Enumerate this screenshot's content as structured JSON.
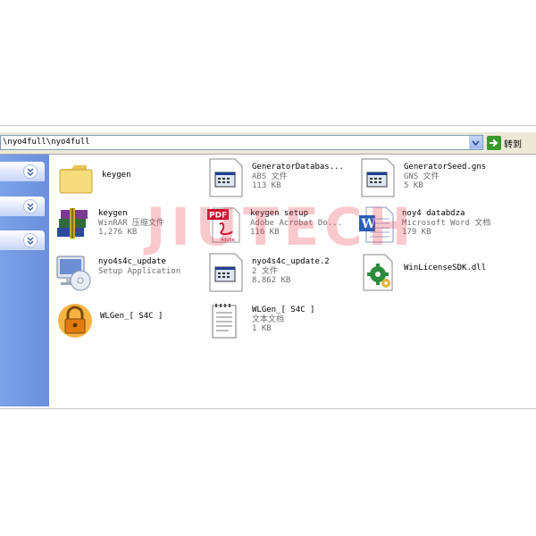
{
  "address_bar": {
    "path": "\\nyo4full\\nyo4full",
    "go_label": "转到"
  },
  "files": [
    {
      "name": "keygen",
      "type": "",
      "size": "",
      "icon": "folder-icon"
    },
    {
      "name": "GeneratorDatabas...",
      "type": "ABS 文件",
      "size": "113 KB",
      "icon": "generic-file-icon"
    },
    {
      "name": "GeneratorSeed.gns",
      "type": "GNS 文件",
      "size": "5 KB",
      "icon": "generic-file-icon"
    },
    {
      "name": "keygen",
      "type": "WinRAR 压缩文件",
      "size": "1,276 KB",
      "icon": "winrar-archive-icon"
    },
    {
      "name": "keygen setup",
      "type": "Adobe Acrobat Do...",
      "size": "116 KB",
      "icon": "pdf-icon"
    },
    {
      "name": "noy4 databdza",
      "type": "Microsoft Word 文档",
      "size": "179 KB",
      "icon": "word-document-icon"
    },
    {
      "name": "nyo4s4c_update",
      "type": "Setup Application",
      "size": "",
      "icon": "setup-cd-icon"
    },
    {
      "name": "nyo4s4c_update.2",
      "type": "2 文件",
      "size": "8,862 KB",
      "icon": "generic-file-icon"
    },
    {
      "name": "WinLicenseSDK.dll",
      "type": "",
      "size": "",
      "icon": "dll-gear-icon"
    },
    {
      "name": "WLGen_[ S4C ]",
      "type": "",
      "size": "",
      "icon": "padlock-icon"
    },
    {
      "name": "WLGen_[ S4C ]",
      "type": "文本文档",
      "size": "1 KB",
      "icon": "text-document-icon"
    }
  ],
  "watermark": "JIUTECH"
}
